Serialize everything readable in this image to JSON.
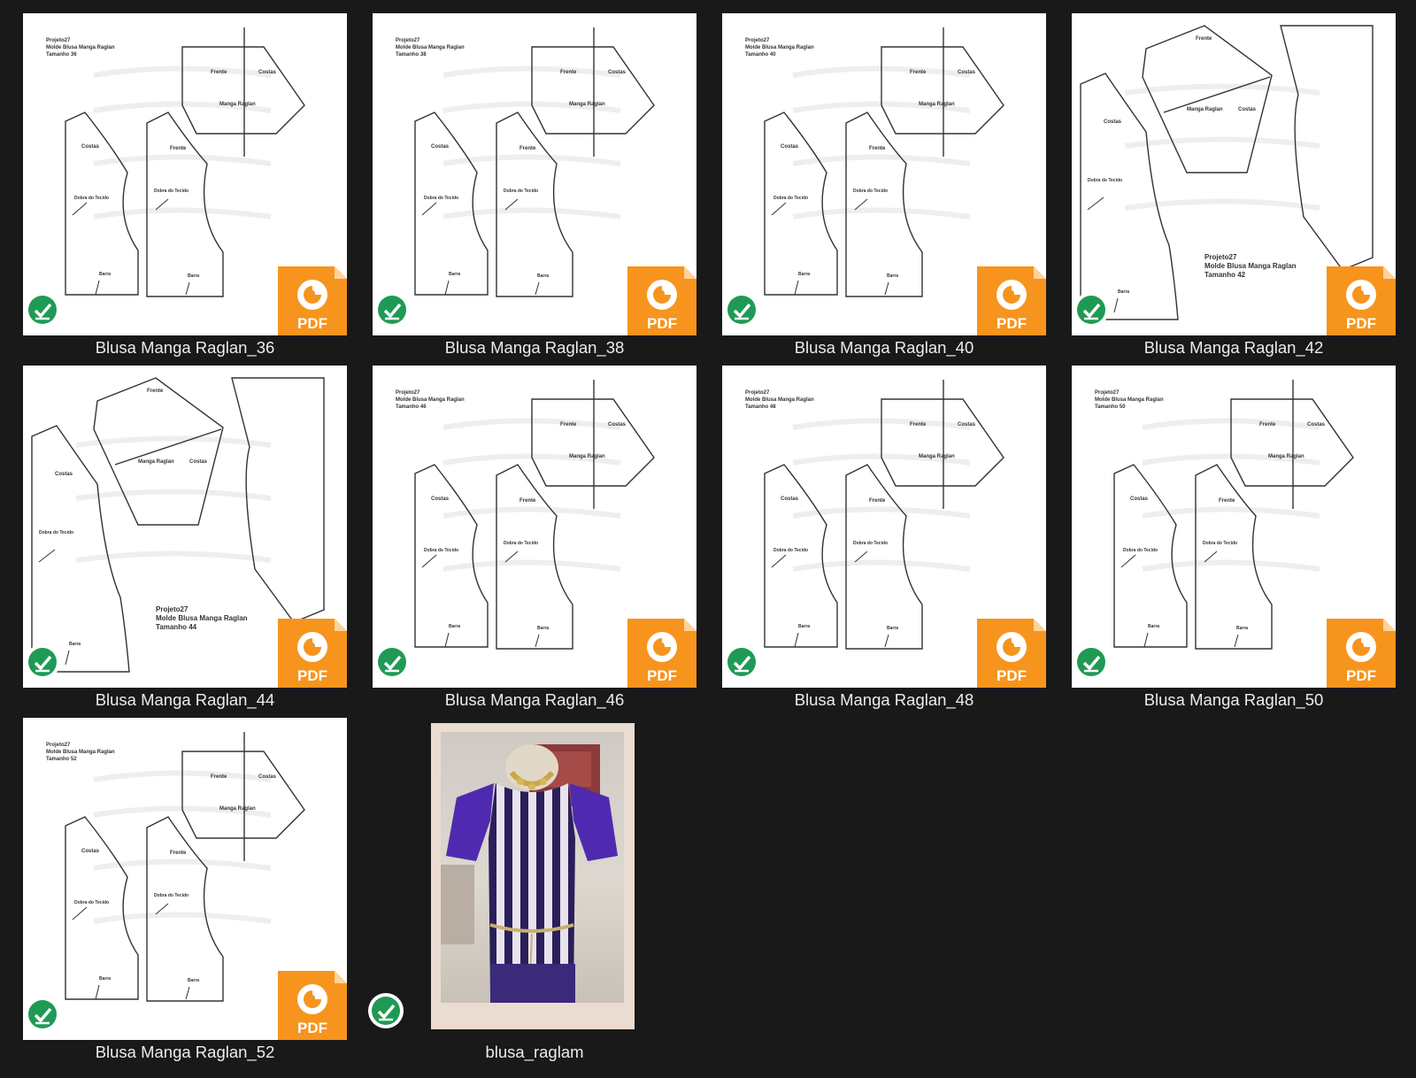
{
  "files": [
    {
      "name": "Blusa Manga Raglan_36",
      "type": "pdf",
      "synced": true
    },
    {
      "name": "Blusa Manga Raglan_38",
      "type": "pdf",
      "synced": true
    },
    {
      "name": "Blusa Manga Raglan_40",
      "type": "pdf",
      "synced": true
    },
    {
      "name": "Blusa Manga Raglan_42",
      "type": "pdf",
      "synced": true
    },
    {
      "name": "Blusa Manga Raglan_44",
      "type": "pdf",
      "synced": true
    },
    {
      "name": "Blusa Manga Raglan_46",
      "type": "pdf",
      "synced": true
    },
    {
      "name": "Blusa Manga Raglan_48",
      "type": "pdf",
      "synced": true
    },
    {
      "name": "Blusa Manga Raglan_50",
      "type": "pdf",
      "synced": true
    },
    {
      "name": "Blusa Manga Raglan_52",
      "type": "pdf",
      "synced": true
    },
    {
      "name": "blusa_raglam",
      "type": "image",
      "synced": true
    }
  ],
  "pdf_badge": {
    "label": "PDF",
    "color": "#f7941d",
    "icon": "foxit-pdf-icon"
  },
  "sync_icon": {
    "icon": "check-circle-icon",
    "color": "#1f9a55"
  },
  "pattern_labels": {
    "project": "Projeto27",
    "mold": "Molde Blusa Manga Raglan",
    "sizes": [
      "Tamanho 36",
      "Tamanho 38",
      "Tamanho 40",
      "Tamanho 42",
      "Tamanho 44",
      "Tamanho 46",
      "Tamanho 48",
      "Tamanho 50",
      "Tamanho 52"
    ],
    "back": "Costas",
    "front": "Frente",
    "sleeve": "Manga Raglan",
    "fold": "Dobra do Tecido",
    "hem": "Barra",
    "sleeve_mark": "Manga"
  },
  "colors": {
    "background": "#191919",
    "caption": "#ececec",
    "pattern_line": "#333333"
  }
}
